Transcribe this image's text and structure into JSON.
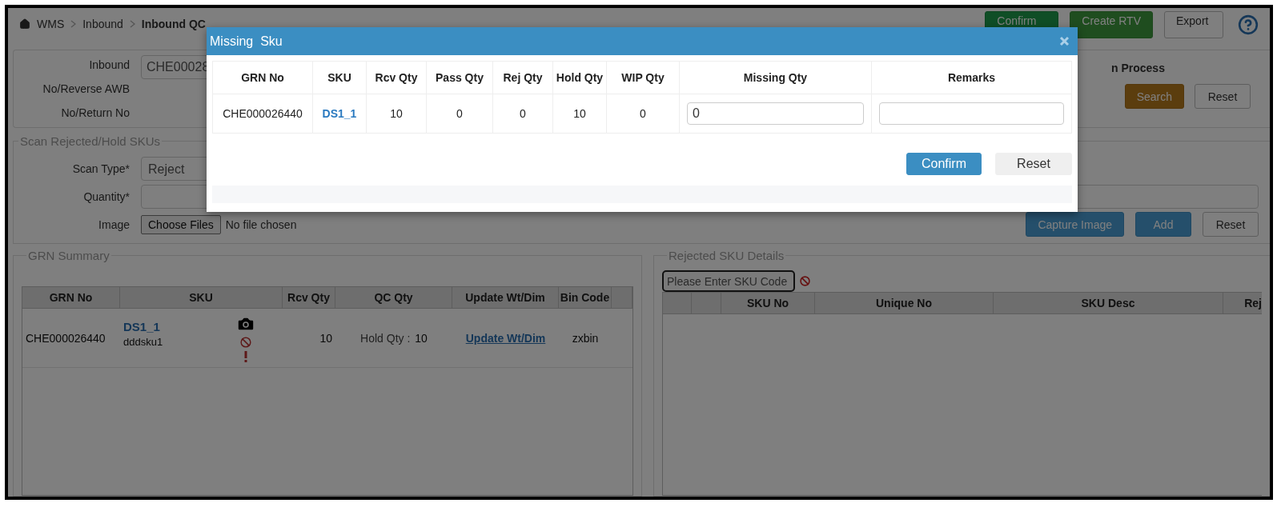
{
  "breadcrumb": [
    {
      "label": "WMS",
      "current": false
    },
    {
      "label": "Inbound",
      "current": false
    },
    {
      "label": "Inbound QC",
      "current": true
    }
  ],
  "header_buttons": [
    {
      "label": "Confirm",
      "kind": "success"
    },
    {
      "label": "Create RTV",
      "kind": "success-light"
    },
    {
      "label": "Export",
      "kind": "default"
    }
  ],
  "filter": {
    "labels": [
      "Inbound",
      "No/Reverse AWB",
      "No/Return No"
    ],
    "inbound_value": "CHE00028",
    "status_label": "n Process",
    "buttons": [
      {
        "label": "Search",
        "kind": "warning"
      },
      {
        "label": "Reset",
        "kind": "default"
      }
    ]
  },
  "scan": {
    "legend": "Scan Rejected/Hold SKUs",
    "scan_type_label": "Scan Type*",
    "scan_type_value": "Reject",
    "quantity_label": "Quantity*",
    "image_label": "Image",
    "file_button": "Choose Files",
    "file_status": "No file chosen",
    "buttons": [
      {
        "label": "Capture Image",
        "kind": "primary-dark"
      },
      {
        "label": "Add",
        "kind": "primary-dark"
      },
      {
        "label": "Reset",
        "kind": "default"
      }
    ]
  },
  "grn_summary": {
    "legend": "GRN Summary",
    "columns": [
      "GRN No",
      "SKU",
      "Rcv Qty",
      "QC Qty",
      "Update Wt/Dim",
      "Bin Code"
    ],
    "rows": [
      {
        "grn_no": "CHE000026440",
        "sku_code": "DS1_1",
        "sku_desc": "dddsku1",
        "rcv_qty": "10",
        "qc_label": "Hold Qty :",
        "qc_value": "10",
        "update_link": "Update Wt/Dim",
        "bin_code": "zxbin"
      }
    ]
  },
  "rejected": {
    "legend": "Rejected SKU Details",
    "search_placeholder": "Please Enter SKU Code",
    "columns": [
      "SKU No",
      "Unique No",
      "SKU Desc",
      "Rej"
    ]
  },
  "modal": {
    "title": "Missing  Sku",
    "columns": [
      "GRN No",
      "SKU",
      "Rcv Qty",
      "Pass Qty",
      "Rej Qty",
      "Hold Qty",
      "WIP Qty",
      "Missing Qty",
      "Remarks"
    ],
    "rows": [
      {
        "grn_no": "CHE000026440",
        "sku": "DS1_1",
        "rcv_qty": "10",
        "pass_qty": "0",
        "rej_qty": "0",
        "hold_qty": "10",
        "wip_qty": "0",
        "missing_qty": "0"
      }
    ],
    "buttons": [
      {
        "label": "Confirm",
        "kind": "primary"
      },
      {
        "label": "Reset",
        "kind": "light"
      }
    ]
  }
}
